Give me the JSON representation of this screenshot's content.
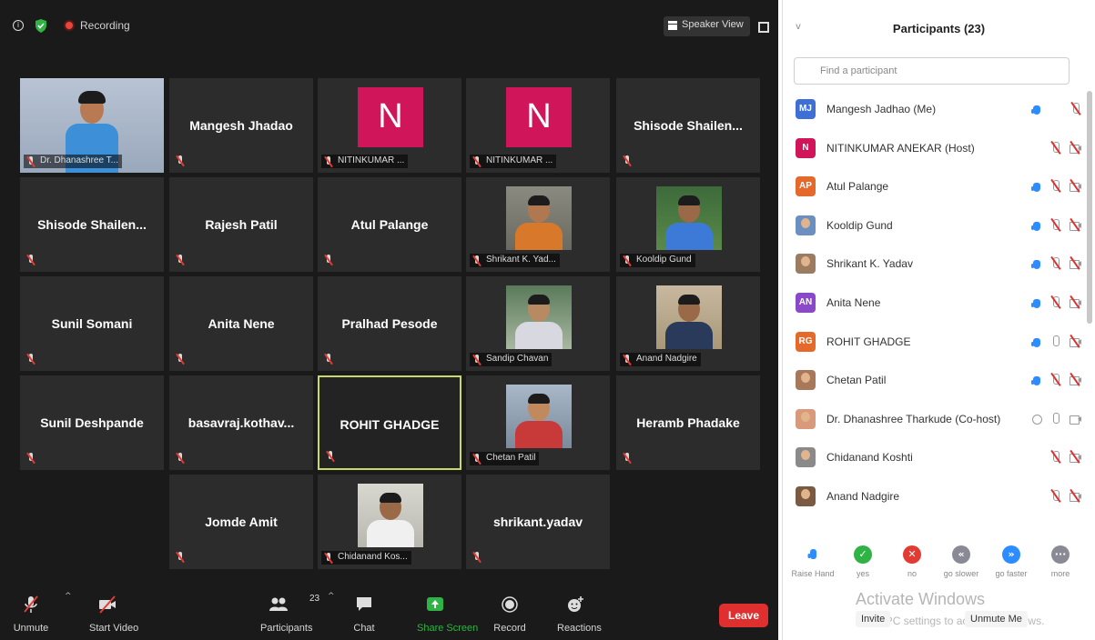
{
  "topbar": {
    "recording_label": "Recording",
    "view_label": "Speaker View",
    "icons": [
      "info-icon",
      "shield-icon",
      "recording-icon",
      "speaker-view-icon",
      "fullscreen-icon"
    ]
  },
  "tiles": [
    {
      "name": "",
      "label": "Dr. Dhanashree T...",
      "kind": "photo",
      "photo": "woman-teacher"
    },
    {
      "name": "Mangesh Jhadao",
      "label": "",
      "kind": "name"
    },
    {
      "name": "",
      "label": "NITINKUMAR ...",
      "kind": "avatar",
      "initial": "N"
    },
    {
      "name": "",
      "label": "NITINKUMAR ...",
      "kind": "avatar",
      "initial": "N"
    },
    {
      "name": "Shisode  Shailen...",
      "label": "",
      "kind": "name"
    },
    {
      "name": "Shisode  Shailen...",
      "label": "",
      "kind": "name",
      "nomic": true
    },
    {
      "name": "Rajesh Patil",
      "label": "",
      "kind": "name"
    },
    {
      "name": "Atul Palange",
      "label": "",
      "kind": "name"
    },
    {
      "name": "",
      "label": "Shrikant K. Yad...",
      "kind": "photo",
      "photo": "man-orange"
    },
    {
      "name": "",
      "label": "Kooldip Gund",
      "kind": "photo",
      "photo": "man-blue"
    },
    {
      "name": "Sunil Somani",
      "label": "",
      "kind": "name"
    },
    {
      "name": "Anita Nene",
      "label": "",
      "kind": "name"
    },
    {
      "name": "Pralhad Pesode",
      "label": "",
      "kind": "name",
      "nomic": true
    },
    {
      "name": "",
      "label": "Sandip Chavan",
      "kind": "photo",
      "photo": "man-glasses"
    },
    {
      "name": "",
      "label": "Anand Nadgire",
      "kind": "photo",
      "photo": "man-suit"
    },
    {
      "name": "Sunil Deshpande",
      "label": "",
      "kind": "name"
    },
    {
      "name": "basavraj.kothav...",
      "label": "",
      "kind": "name"
    },
    {
      "name": "ROHIT GHADGE",
      "label": "",
      "kind": "name",
      "active": true,
      "nomic": true
    },
    {
      "name": "",
      "label": "Chetan Patil",
      "kind": "photo",
      "photo": "man-red"
    },
    {
      "name": "Heramb Phadake",
      "label": "",
      "kind": "name"
    },
    {
      "name": "Jomde Amit",
      "label": "",
      "kind": "name"
    },
    {
      "name": "",
      "label": "Chidanand Kos...",
      "kind": "photo",
      "photo": "man-white"
    },
    {
      "name": "shrikant.yadav",
      "label": "",
      "kind": "name"
    }
  ],
  "controls": {
    "unmute": "Unmute",
    "start_video": "Start Video",
    "participants": "Participants",
    "participants_count": "23",
    "chat": "Chat",
    "share_screen": "Share Screen",
    "record": "Record",
    "reactions": "Reactions",
    "leave": "Leave",
    "icons": [
      "mic-muted-icon",
      "video-off-icon",
      "participants-icon",
      "chat-icon",
      "share-screen-icon",
      "record-icon",
      "reactions-icon"
    ]
  },
  "panel": {
    "title": "Participants (23)",
    "search_placeholder": "Find a participant",
    "participants": [
      {
        "name": "Mangesh Jadhao (Me)",
        "initials": "MJ",
        "color": "#3d6fd6",
        "hand": true,
        "mic": "muted",
        "cam": "none"
      },
      {
        "name": "NITINKUMAR ANEKAR (Host)",
        "initials": "N",
        "color": "#d0155a",
        "hand": false,
        "mic": "muted",
        "cam": "off"
      },
      {
        "name": "Atul Palange",
        "initials": "AP",
        "color": "#e5692a",
        "hand": true,
        "mic": "muted",
        "cam": "off"
      },
      {
        "name": "Kooldip Gund",
        "initials": "",
        "color": "#6a8fc0",
        "hand": true,
        "mic": "muted",
        "cam": "off"
      },
      {
        "name": "Shrikant K. Yadav",
        "initials": "",
        "color": "#9c7c60",
        "hand": true,
        "mic": "muted",
        "cam": "off"
      },
      {
        "name": "Anita Nene",
        "initials": "AN",
        "color": "#8a49c9",
        "hand": true,
        "mic": "muted",
        "cam": "off"
      },
      {
        "name": "ROHIT GHADGE",
        "initials": "RG",
        "color": "#e5692a",
        "hand": true,
        "mic": "on",
        "cam": "off"
      },
      {
        "name": "Chetan Patil",
        "initials": "",
        "color": "#a8785a",
        "hand": true,
        "mic": "muted",
        "cam": "off"
      },
      {
        "name": "Dr. Dhanashree Tharkude (Co-host)",
        "initials": "",
        "color": "#d89a7a",
        "hand": false,
        "share": true,
        "mic": "on",
        "cam": "on"
      },
      {
        "name": "Chidanand Koshti",
        "initials": "",
        "color": "#8a8a8a",
        "hand": false,
        "mic": "muted",
        "cam": "off"
      },
      {
        "name": "Anand Nadgire",
        "initials": "",
        "color": "#7a5a40",
        "hand": false,
        "mic": "muted",
        "cam": "off"
      }
    ],
    "feedback": [
      {
        "label": "Raise Hand",
        "color": "#ffffff",
        "glyph": "hand"
      },
      {
        "label": "yes",
        "color": "#2fb344",
        "glyph": "✓"
      },
      {
        "label": "no",
        "color": "#e23b33",
        "glyph": "✕"
      },
      {
        "label": "go slower",
        "color": "#8a8a96",
        "glyph": "«"
      },
      {
        "label": "go faster",
        "color": "#2d8cff",
        "glyph": "»"
      },
      {
        "label": "more",
        "color": "#8a8a96",
        "glyph": "···"
      }
    ],
    "invite": "Invite",
    "unmute_me": "Unmute Me",
    "watermark_title": "Activate Windows",
    "watermark_sub": "Go to PC settings to activate Windows."
  }
}
